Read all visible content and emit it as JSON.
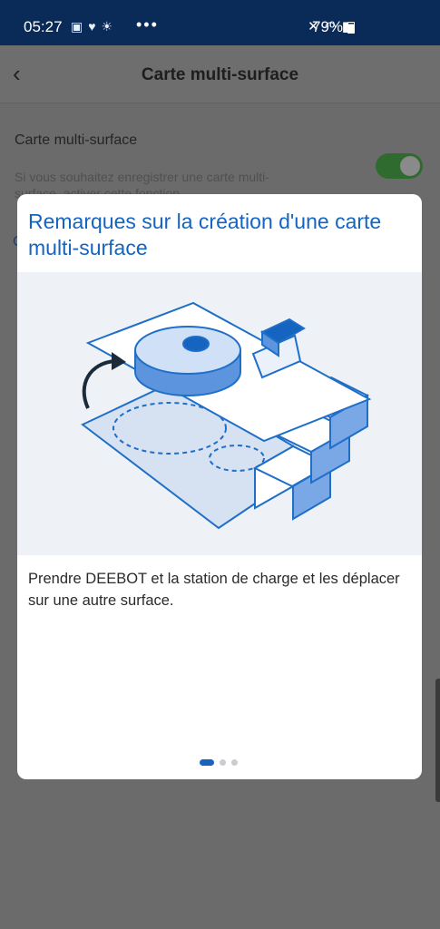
{
  "status_bar": {
    "time": "05:27",
    "more": "•••",
    "battery": "79%"
  },
  "app_bar": {
    "back_icon": "‹",
    "title": "Carte multi-surface"
  },
  "setting": {
    "label": "Carte multi-surface",
    "description": "Si vous souhaitez enregistrer une carte multi-surface, activer cette fonction.",
    "enabled": true
  },
  "dialog": {
    "title": "Remarques sur la création d'une carte multi-surface",
    "body": "Prendre DEEBOT et la station de charge et les déplacer sur une autre surface.",
    "page_count": 3,
    "current_page": 1
  },
  "colors": {
    "accent": "#1565c0",
    "status_bar": "#0a2a57",
    "overlay": "#6b6b6b"
  }
}
